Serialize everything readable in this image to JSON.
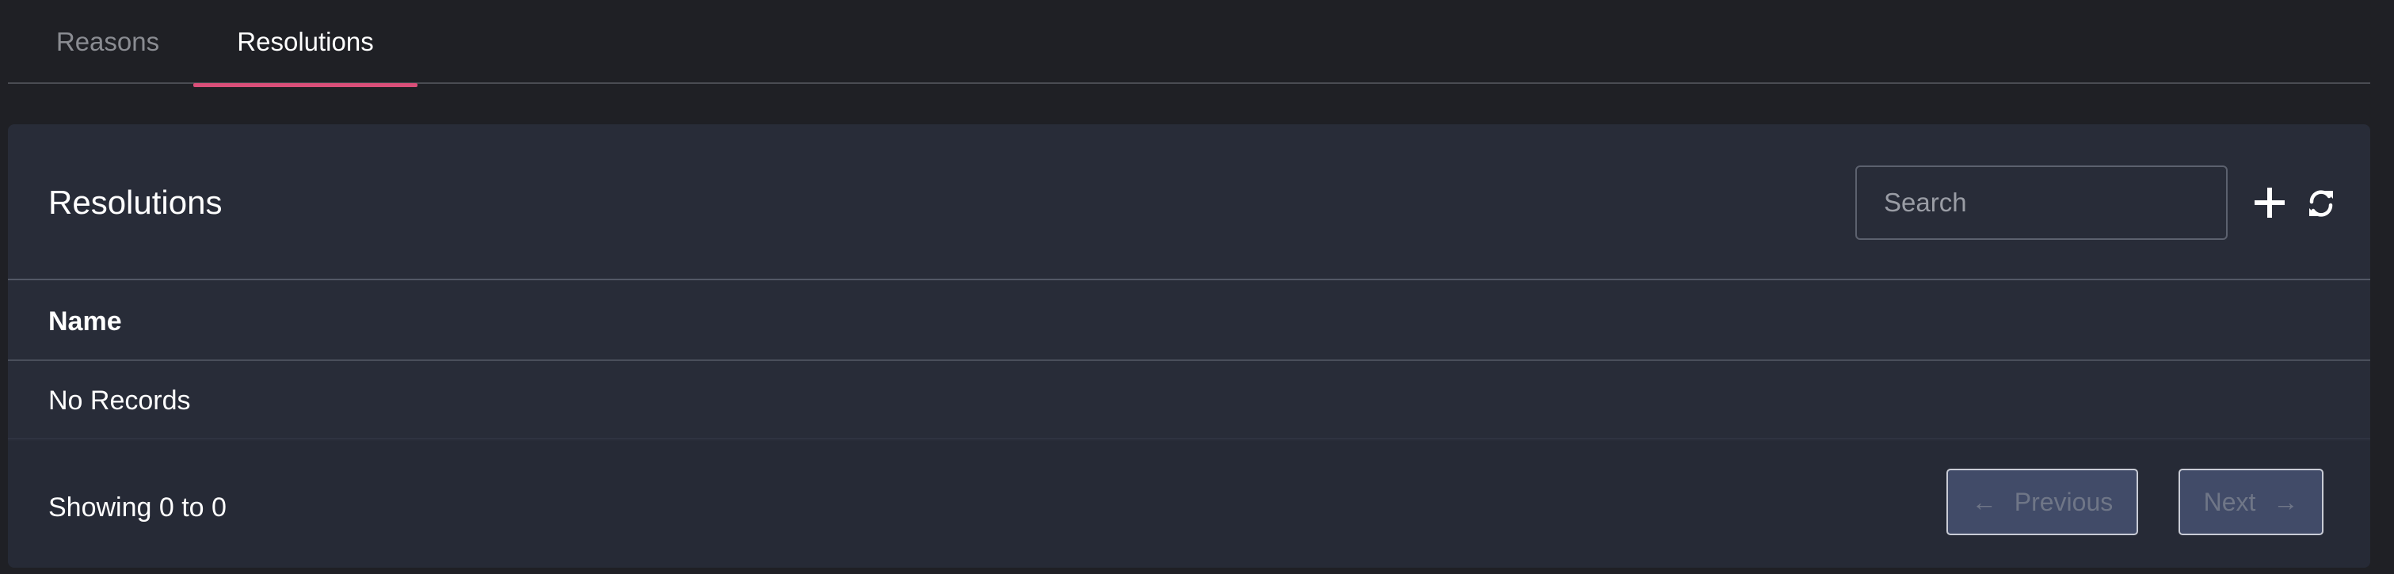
{
  "tabs": [
    {
      "label": "Reasons",
      "active": false
    },
    {
      "label": "Resolutions",
      "active": true
    }
  ],
  "colors": {
    "background": "#1f2025",
    "card": "#282c38",
    "accent": "#d94f79",
    "button": "#414b68"
  },
  "card": {
    "title": "Resolutions",
    "search": {
      "placeholder": "Search",
      "value": ""
    },
    "icons": {
      "add": "plus-icon",
      "refresh": "refresh-icon"
    }
  },
  "table": {
    "columns": [
      "Name"
    ],
    "empty_text": "No Records"
  },
  "footer": {
    "showing": "Showing 0 to 0",
    "previous": {
      "arrow": "←",
      "label": "Previous"
    },
    "next": {
      "label": "Next",
      "arrow": "→"
    }
  }
}
